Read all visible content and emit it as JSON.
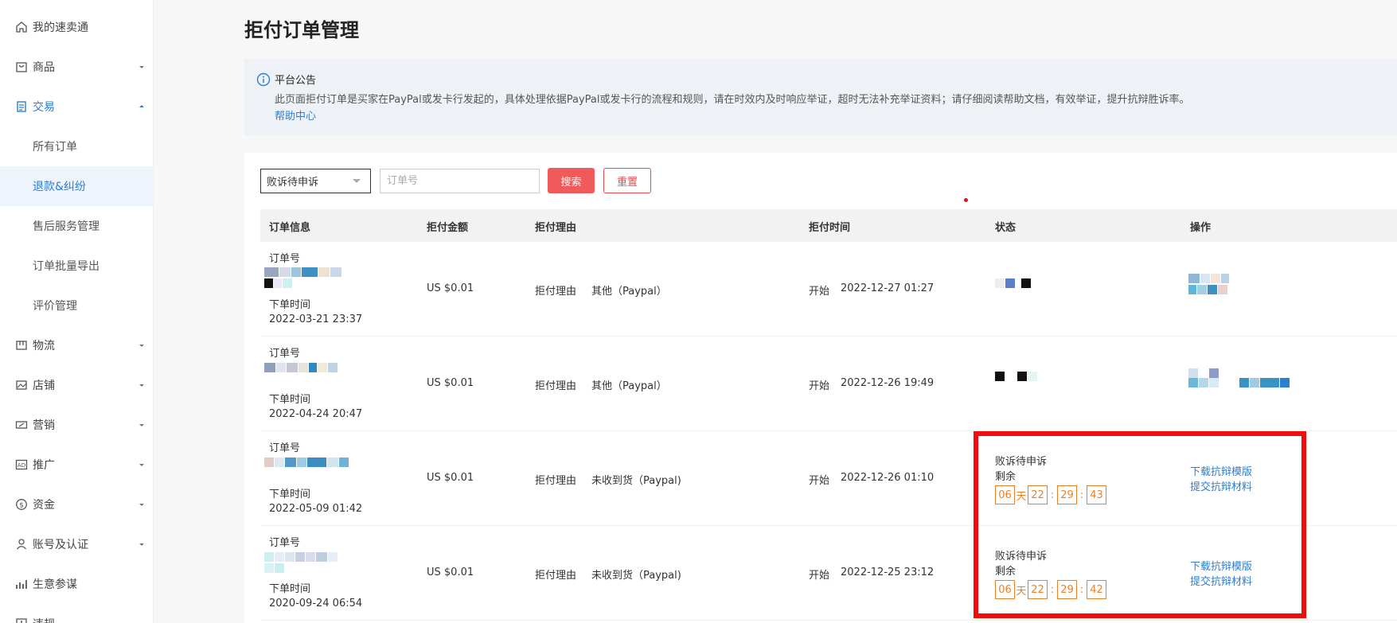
{
  "sidebar": {
    "items": [
      {
        "label": "我的速卖通",
        "icon": "home-icon"
      },
      {
        "label": "商品",
        "icon": "bag-icon"
      },
      {
        "label": "交易",
        "icon": "clipboard-icon"
      },
      {
        "label": "物流",
        "icon": "truck-icon"
      },
      {
        "label": "店铺",
        "icon": "picture-icon"
      },
      {
        "label": "营销",
        "icon": "ticket-icon"
      },
      {
        "label": "推广",
        "icon": "ad-icon"
      },
      {
        "label": "资金",
        "icon": "dollar-icon"
      },
      {
        "label": "账号及认证",
        "icon": "user-icon"
      },
      {
        "label": "生意参谋",
        "icon": "chart-icon"
      },
      {
        "label": "违规",
        "icon": "warning-icon"
      }
    ],
    "sub_items": [
      "所有订单",
      "退款&纠纷",
      "售后服务管理",
      "订单批量导出",
      "评价管理"
    ]
  },
  "page": {
    "title": "拒付订单管理"
  },
  "notice": {
    "title": "平台公告",
    "text": "此页面拒付订单是买家在PayPal或发卡行发起的，具体处理依据PayPal或发卡行的流程和规则，请在时效内及时响应举证，超时无法补充举证资料；请仔细阅读帮助文档，有效举证，提升抗辩胜诉率。",
    "link": "帮助中心"
  },
  "filters": {
    "status_selected": "败诉待申诉",
    "order_placeholder": "订单号",
    "search_label": "搜索",
    "reset_label": "重置"
  },
  "table": {
    "headers": [
      "订单信息",
      "拒付金额",
      "拒付理由",
      "拒付时间",
      "状态",
      "操作"
    ],
    "rows": [
      {
        "order_label": "订单号",
        "order_time_label": "下单时间",
        "order_time": "2022-03-21 23:37",
        "amount": "US $0.01",
        "reason_label": "拒付理由",
        "reason": "其他（Paypal）",
        "time_label": "开始",
        "time": "2022-12-27 01:27"
      },
      {
        "order_label": "订单号",
        "order_time_label": "下单时间",
        "order_time": "2022-04-24 20:47",
        "amount": "US $0.01",
        "reason_label": "拒付理由",
        "reason": "其他（Paypal）",
        "time_label": "开始",
        "time": "2022-12-26 19:49"
      },
      {
        "order_label": "订单号",
        "order_time_label": "下单时间",
        "order_time": "2022-05-09 01:42",
        "amount": "US $0.01",
        "reason_label": "拒付理由",
        "reason": "未收到货（Paypal)",
        "time_label": "开始",
        "time": "2022-12-26 01:10",
        "status": "败诉待申诉",
        "remaining_label": "剩余",
        "timer": {
          "days": "06",
          "day_unit": "天",
          "hours": "22",
          "minutes": "29",
          "seconds": "43"
        },
        "actions": [
          "下载抗辩模版",
          "提交抗辩材料"
        ]
      },
      {
        "order_label": "订单号",
        "order_time_label": "下单时间",
        "order_time": "2020-09-24 06:54",
        "amount": "US $0.01",
        "reason_label": "拒付理由",
        "reason": "未收到货（Paypal)",
        "time_label": "开始",
        "time": "2022-12-25 23:12",
        "status": "败诉待申诉",
        "remaining_label": "剩余",
        "timer": {
          "days": "06",
          "day_unit": "天",
          "hours": "22",
          "minutes": "29",
          "seconds": "42"
        },
        "actions": [
          "下载抗辩模版",
          "提交抗辩材料"
        ]
      }
    ]
  },
  "colors": {
    "accent": "#2d7dd2",
    "danger": "#f05a5a",
    "timer": "#e8812c",
    "highlight": "#f20c0c"
  }
}
